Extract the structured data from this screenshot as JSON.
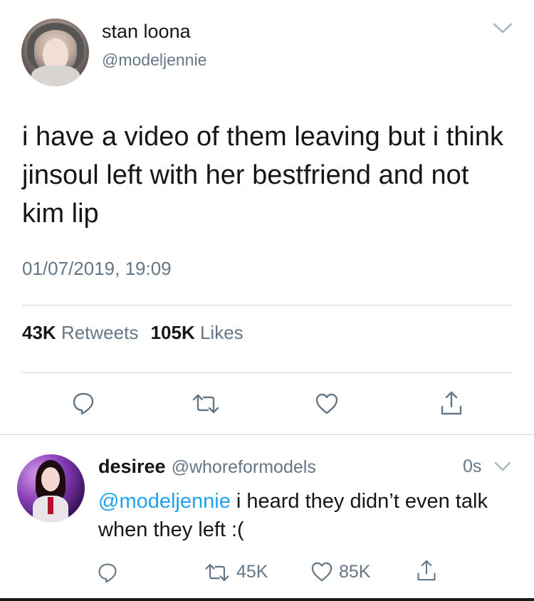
{
  "main_tweet": {
    "display_name": "stan loona",
    "handle": "@modeljennie",
    "text": "i have a video of them leaving but i think jinsoul left with her bestfriend and not kim lip",
    "timestamp": "01/07/2019, 19:09",
    "retweets_count": "43K",
    "retweets_label": "Retweets",
    "likes_count": "105K",
    "likes_label": "Likes",
    "actions": [
      "reply-icon",
      "retweet-icon",
      "heart-icon",
      "share-icon"
    ]
  },
  "reply": {
    "display_name": "desiree",
    "handle": "@whoreformodels",
    "time": "0s",
    "mention": "@modeljennie",
    "text": " i heard they didn’t even talk when they left :(",
    "retweet_count": "45K",
    "like_count": "85K",
    "actions": [
      "reply-icon",
      "retweet-icon",
      "heart-icon",
      "share-icon"
    ]
  },
  "colors": {
    "text": "#14171a",
    "secondary": "#657786",
    "accent": "#1da1f2",
    "divider": "#ccd6dd"
  }
}
